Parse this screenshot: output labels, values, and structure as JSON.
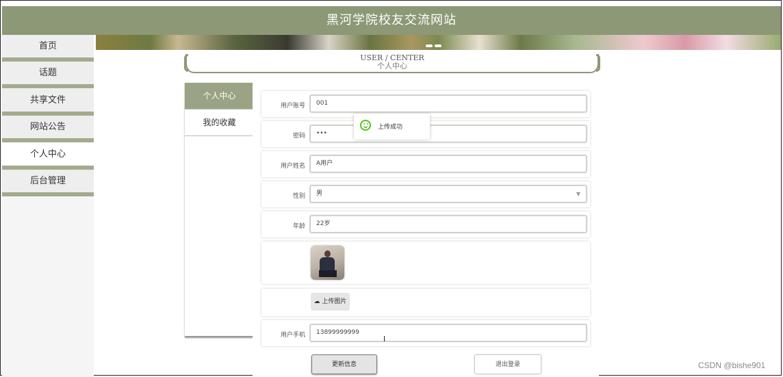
{
  "header": {
    "title": "黑河学院校友交流网站"
  },
  "nav": {
    "items": [
      {
        "label": "首页"
      },
      {
        "label": "话题"
      },
      {
        "label": "共享文件"
      },
      {
        "label": "网站公告"
      },
      {
        "label": "个人中心"
      },
      {
        "label": "后台管理"
      }
    ],
    "active": "个人中心"
  },
  "user_center": {
    "title_en": "USER / CENTER",
    "title_cn": "个人中心"
  },
  "sub_menu": {
    "items": [
      {
        "label": "个人中心"
      },
      {
        "label": "我的收藏"
      }
    ]
  },
  "form": {
    "account": {
      "label": "用户账号",
      "value": "001"
    },
    "password": {
      "label": "密码",
      "value": "•••"
    },
    "name": {
      "label": "用户姓名",
      "value": "A用户"
    },
    "gender": {
      "label": "性别",
      "value": "男"
    },
    "age": {
      "label": "年龄",
      "value": "22岁"
    },
    "upload": {
      "label": "上传图片"
    },
    "phone": {
      "label": "用户手机",
      "value": "13899999999"
    }
  },
  "buttons": {
    "update": "更新信息",
    "logout": "退出登录"
  },
  "toast": {
    "message": "上传成功"
  },
  "watermark": "CSDN @bishe901",
  "colors": {
    "header_bg": "#8d9876",
    "accent": "#a2ab8d",
    "success": "#52c41a"
  },
  "icons": {
    "toast": "smile-icon",
    "upload": "cloud-upload-icon",
    "select": "chevron-down-icon"
  }
}
